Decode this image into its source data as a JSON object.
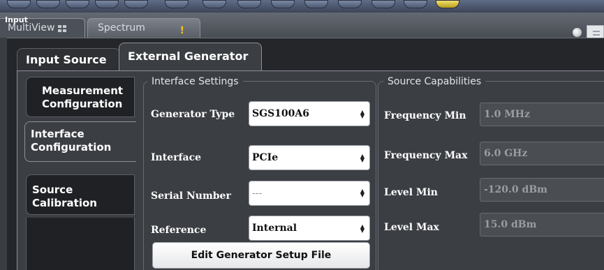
{
  "window": {
    "dialog_title": "Input",
    "bg_tabs": {
      "multiview": "MultiView",
      "spectrum": "Spectrum"
    }
  },
  "top_tabs": [
    {
      "label": "Input Source",
      "active": false
    },
    {
      "label": "External Generator",
      "active": true
    }
  ],
  "side_tabs": [
    {
      "label": "Measurement\nConfiguration",
      "active": false
    },
    {
      "label": "Interface\nConfiguration",
      "active": true
    },
    {
      "label": "Source\nCalibration",
      "active": false
    }
  ],
  "interface_settings": {
    "title": "Interface Settings",
    "generator_type": {
      "label": "Generator Type",
      "value": "SGS100A6"
    },
    "interface": {
      "label": "Interface",
      "value": "PCIe"
    },
    "serial_number": {
      "label": "Serial Number",
      "value": "---"
    },
    "reference": {
      "label": "Reference",
      "value": "Internal"
    },
    "edit_button": "Edit Generator Setup File"
  },
  "source_capabilities": {
    "title": "Source Capabilities",
    "frequency_min": {
      "label": "Frequency Min",
      "value": "1.0 MHz"
    },
    "frequency_max": {
      "label": "Frequency Max",
      "value": "6.0 GHz"
    },
    "level_min": {
      "label": "Level Min",
      "value": "-120.0 dBm"
    },
    "level_max": {
      "label": "Level Max",
      "value": "15.0 dBm"
    }
  },
  "icons": {
    "select_arrows": "updown-arrows-icon",
    "warning": "warning-icon",
    "grid": "grid-icon"
  },
  "colors": {
    "panel_bg": "#3b3e43",
    "dialog_bg": "#24262a",
    "inactive_tab_bg": "#1f2124",
    "field_bg": "#ffffff",
    "readonly_field_bg": "#4a4d52"
  }
}
